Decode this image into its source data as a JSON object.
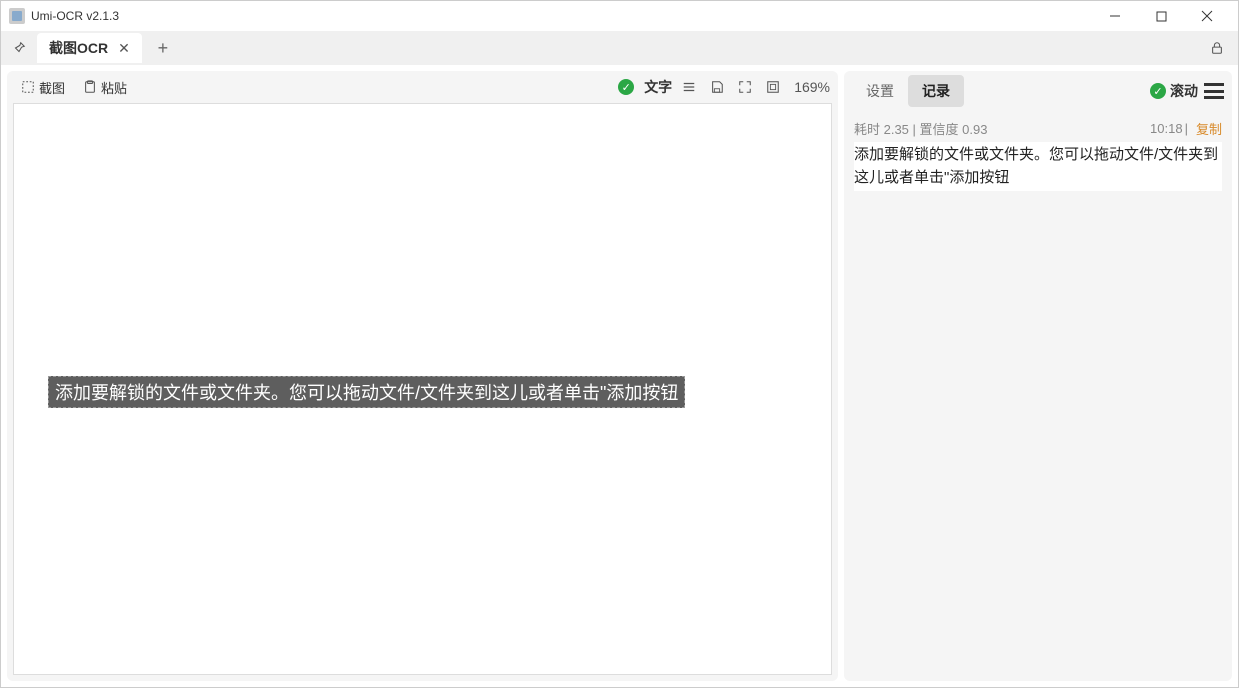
{
  "window": {
    "title": "Umi-OCR v2.1.3"
  },
  "tabs": {
    "main_label": "截图OCR"
  },
  "left_toolbar": {
    "screenshot_label": "截图",
    "paste_label": "粘贴",
    "text_label": "文字",
    "zoom_label": "169%"
  },
  "image": {
    "ocr_overlay_text": "添加要解锁的文件或文件夹。您可以拖动文件/文件夹到这儿或者单击\"添加按钮"
  },
  "right_toolbar": {
    "settings_label": "设置",
    "records_label": "记录",
    "scroll_label": "滚动"
  },
  "record": {
    "meta": "耗时 2.35 | 置信度 0.93",
    "time": "10:18",
    "copy_label": "复制",
    "text": "添加要解锁的文件或文件夹。您可以拖动文件/文件夹到这儿或者单击\"添加按钮"
  }
}
